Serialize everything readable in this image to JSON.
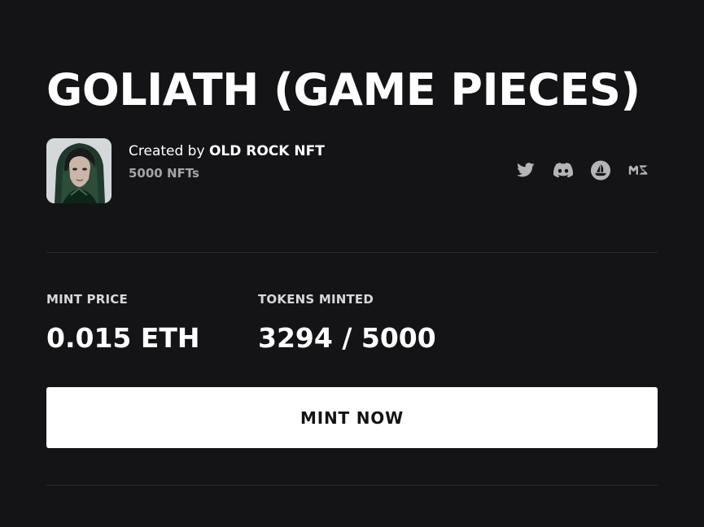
{
  "collection": {
    "title": "GOLIATH (GAME PIECES)",
    "created_by_prefix": "Created by",
    "creator_name": "OLD ROCK NFT",
    "nft_count": "5000 NFTs"
  },
  "socials": [
    {
      "name": "twitter-icon",
      "color": "#b4b4b8"
    },
    {
      "name": "discord-icon",
      "color": "#b4b4b8"
    },
    {
      "name": "opensea-icon",
      "color": "#b4b4b8"
    },
    {
      "name": "magic-eden-icon",
      "color": "#b4b4b8"
    }
  ],
  "stats": {
    "mint_price_label": "MINT PRICE",
    "mint_price_value": "0.015 ETH",
    "tokens_minted_label": "TOKENS MINTED",
    "tokens_minted_value": "3294 / 5000"
  },
  "actions": {
    "mint_label": "MINT NOW"
  },
  "colors": {
    "background": "#141416",
    "text": "#ffffff",
    "muted": "#a3a3a8",
    "divider": "#2d2d31",
    "button_bg": "#ffffff",
    "button_text": "#141416"
  }
}
